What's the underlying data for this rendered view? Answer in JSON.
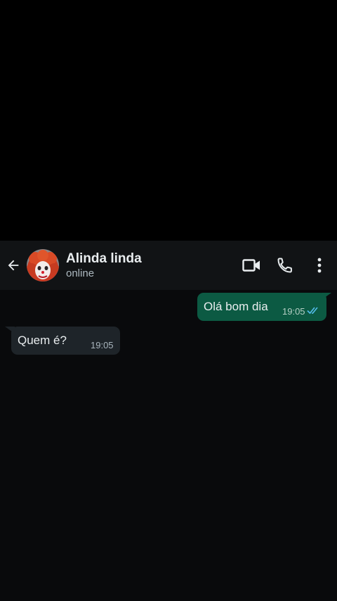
{
  "header": {
    "contact_name": "Alinda linda",
    "status": "online"
  },
  "icons": {
    "back": "arrow-back-icon",
    "video": "video-camera-icon",
    "voice": "phone-icon",
    "menu": "more-vertical-icon",
    "read": "double-check-icon"
  },
  "colors": {
    "header_bg": "#111315",
    "chat_bg": "#090a0c",
    "outgoing_bubble": "#0c5a43",
    "incoming_bubble": "#1e2429",
    "read_ticks": "#53bdeb"
  },
  "messages": [
    {
      "direction": "outgoing",
      "text": "Olá bom dia",
      "time": "19:05",
      "status": "read"
    },
    {
      "direction": "incoming",
      "text": "Quem é?",
      "time": "19:05"
    }
  ]
}
